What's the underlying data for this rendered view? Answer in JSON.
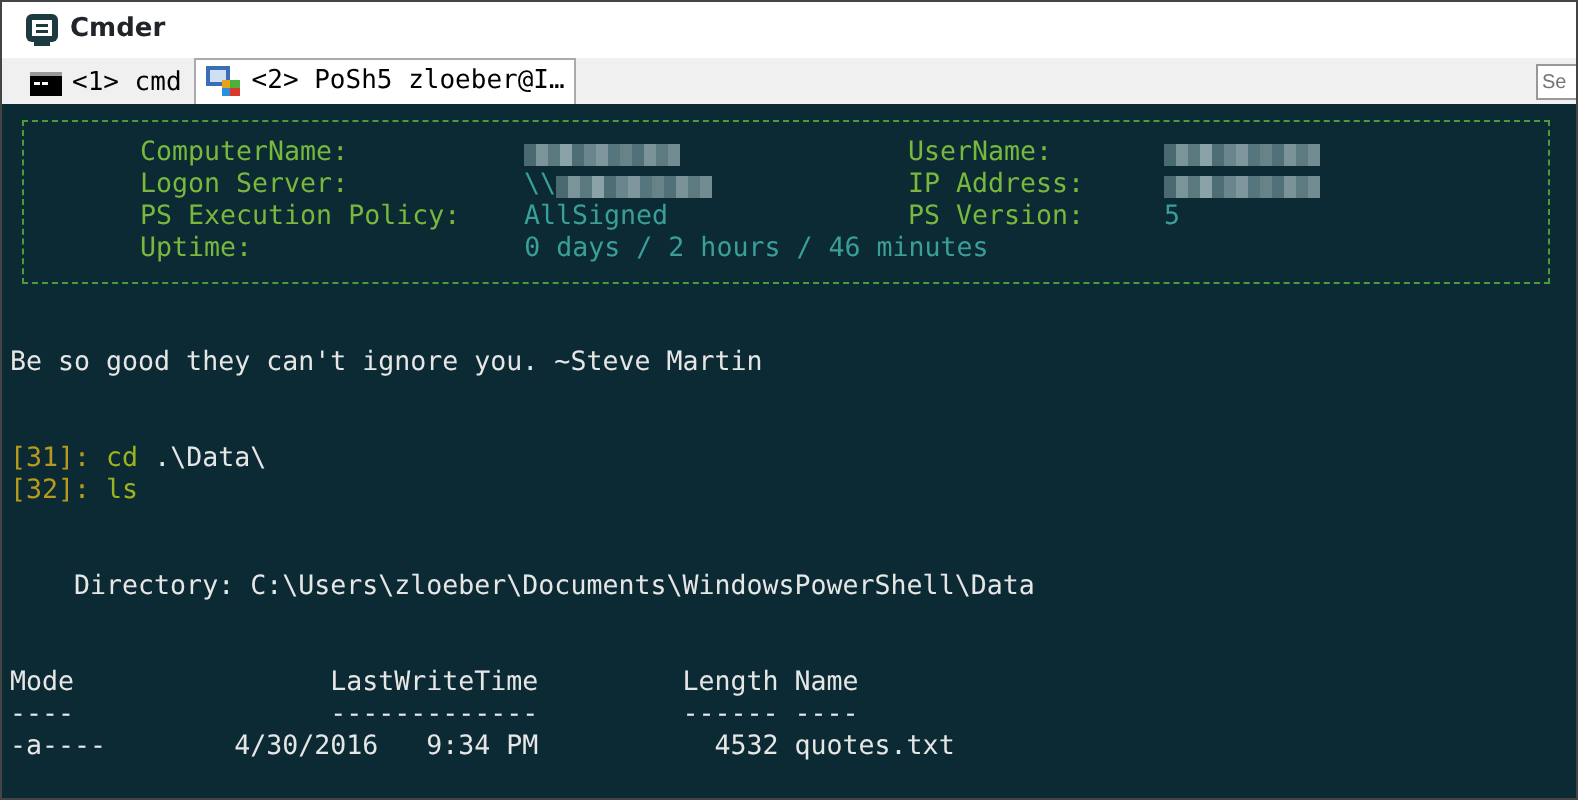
{
  "window": {
    "title": "Cmder"
  },
  "tabs": [
    {
      "label": "<1> cmd",
      "kind": "cmd",
      "selected": false
    },
    {
      "label": "<2> PoSh5 zloeber@I…",
      "kind": "powershell",
      "selected": true
    }
  ],
  "search": {
    "placeholder": "Se"
  },
  "banner": {
    "rows": [
      {
        "left": {
          "label": "ComputerName:",
          "redacted": true
        },
        "right": {
          "label": "UserName:",
          "redacted": true
        }
      },
      {
        "left": {
          "label": "Logon Server:",
          "value": "\\\\",
          "redacted": true
        },
        "right": {
          "label": "IP Address:",
          "redacted": true
        }
      },
      {
        "left": {
          "label": "PS Execution Policy:",
          "value": "AllSigned"
        },
        "right": {
          "label": "PS Version:",
          "value": "5"
        }
      },
      {
        "left": {
          "label": "Uptime:",
          "value": "0 days / 2 hours / 46 minutes"
        }
      }
    ]
  },
  "console": [
    {
      "kind": "blank"
    },
    {
      "kind": "blank"
    },
    {
      "kind": "output",
      "text": "Be so good they can't ignore you. ~Steve Martin"
    },
    {
      "kind": "blank"
    },
    {
      "kind": "blank"
    },
    {
      "kind": "prompt",
      "prompt": "[31]: ",
      "command": "cd",
      "args": " .\\Data\\"
    },
    {
      "kind": "prompt",
      "prompt": "[32]: ",
      "command": "ls"
    },
    {
      "kind": "blank"
    },
    {
      "kind": "blank"
    },
    {
      "kind": "output",
      "text": "    Directory: C:\\Users\\zloeber\\Documents\\WindowsPowerShell\\Data"
    },
    {
      "kind": "blank"
    },
    {
      "kind": "blank"
    },
    {
      "kind": "output",
      "text": "Mode                LastWriteTime         Length Name"
    },
    {
      "kind": "output",
      "text": "----                -------------         ------ ----"
    },
    {
      "kind": "output",
      "text": "-a----        4/30/2016   9:34 PM           4532 quotes.txt"
    }
  ]
}
